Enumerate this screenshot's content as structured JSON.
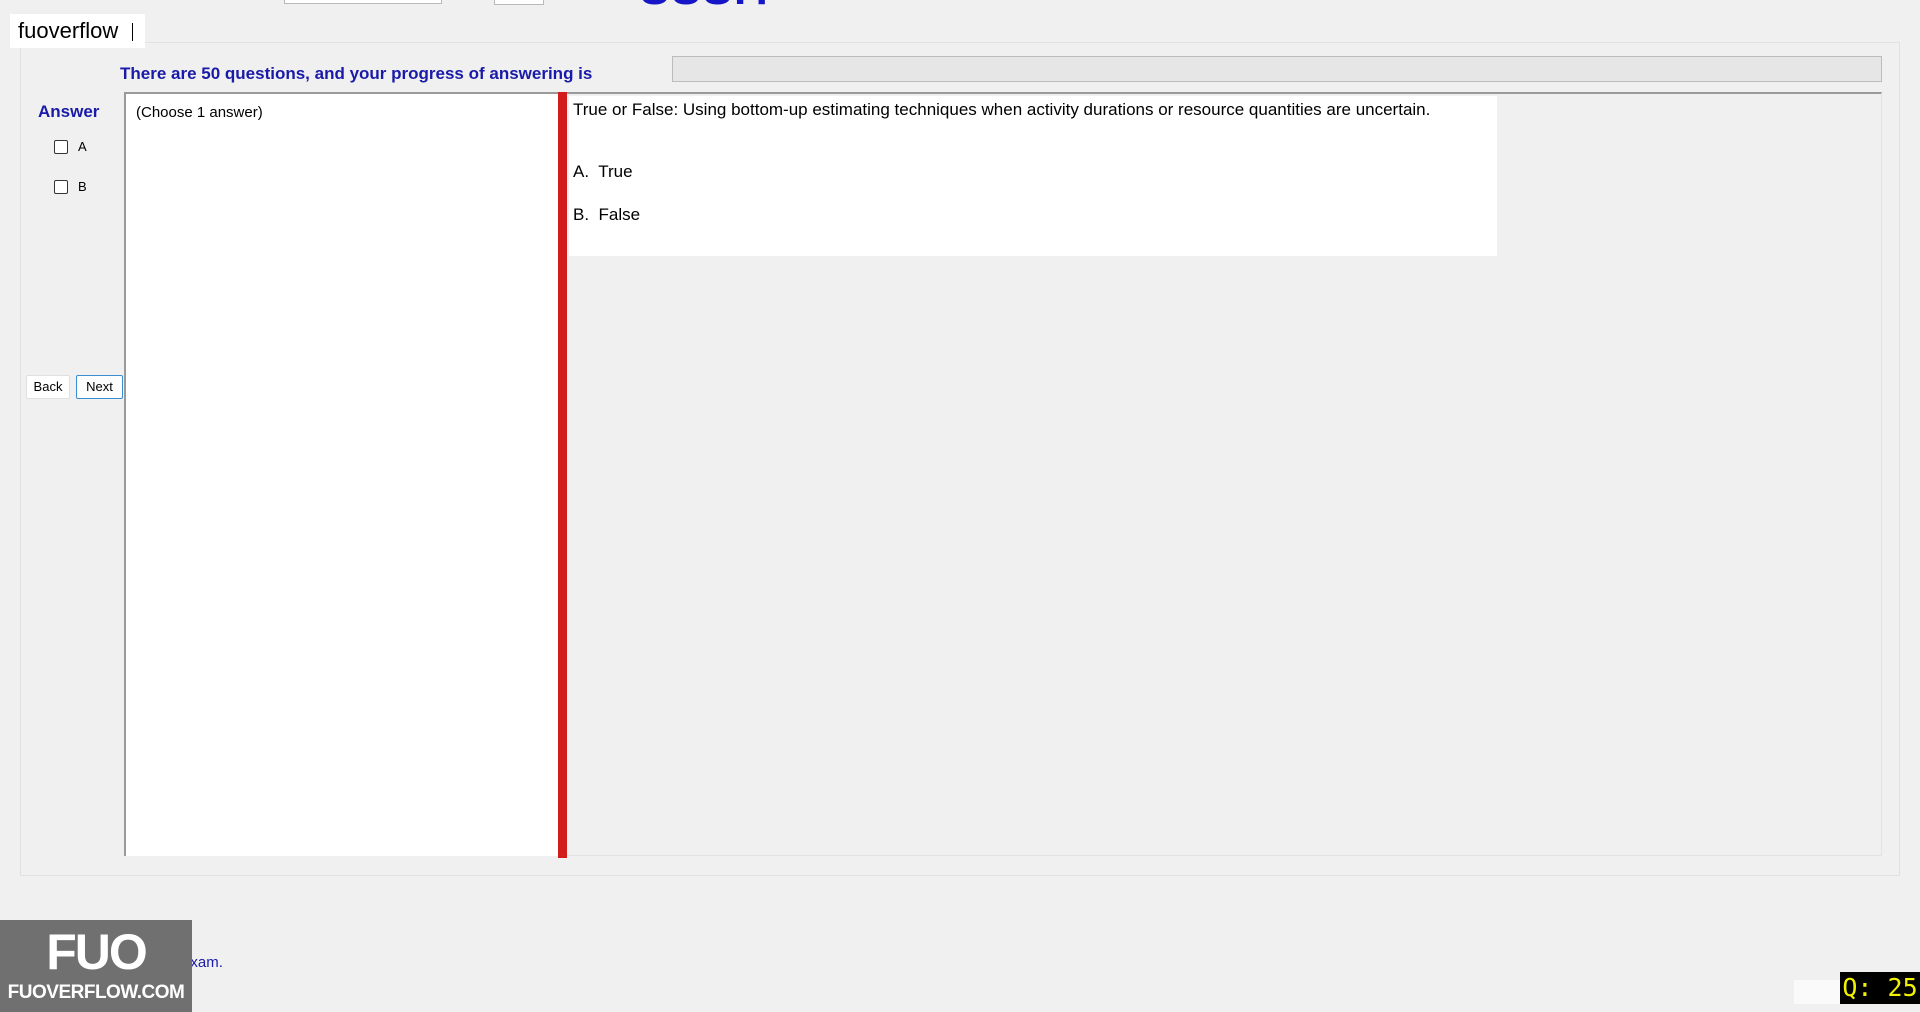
{
  "header": {
    "code_fragment": "SSSIT",
    "watermark": "fuoverflow"
  },
  "progress": {
    "text": "There are 50 questions, and your progress of answering is",
    "fraction": 0
  },
  "answer_panel": {
    "label": "Answer",
    "options": [
      "A",
      "B"
    ]
  },
  "nav": {
    "back_label": "Back",
    "next_label": "Next"
  },
  "note": {
    "text": "(Choose 1 answer)"
  },
  "question": {
    "text": "True or False: Using bottom-up estimating techniques when activity durations or resource quantities are uncertain.",
    "choice_a": "A.  True",
    "choice_b": "B.  False"
  },
  "footer": {
    "finish_label": "I want to finish the exam.",
    "logo_mark": "FUO",
    "logo_site": "FUOVERFLOW.COM",
    "question_counter": "Q: 25"
  }
}
